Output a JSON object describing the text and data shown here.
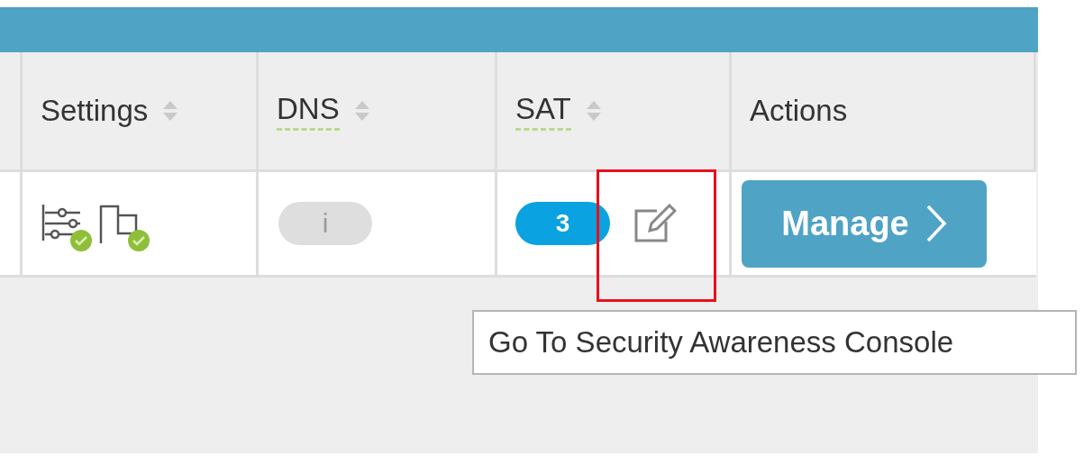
{
  "columns": [
    {
      "label": "Settings",
      "sortable": true,
      "abbr": false
    },
    {
      "label": "DNS",
      "sortable": true,
      "abbr": true
    },
    {
      "label": "SAT",
      "sortable": true,
      "abbr": true
    },
    {
      "label": "Actions",
      "sortable": false,
      "abbr": false
    }
  ],
  "row": {
    "settings": [
      {
        "kind": "sliders",
        "ok": true
      },
      {
        "kind": "flag",
        "ok": true
      }
    ],
    "dns": {
      "label": "i"
    },
    "sat": {
      "count": "3"
    },
    "manage": {
      "label": "Manage"
    }
  },
  "tooltip": {
    "text": "Go To Security Awareness Console"
  }
}
